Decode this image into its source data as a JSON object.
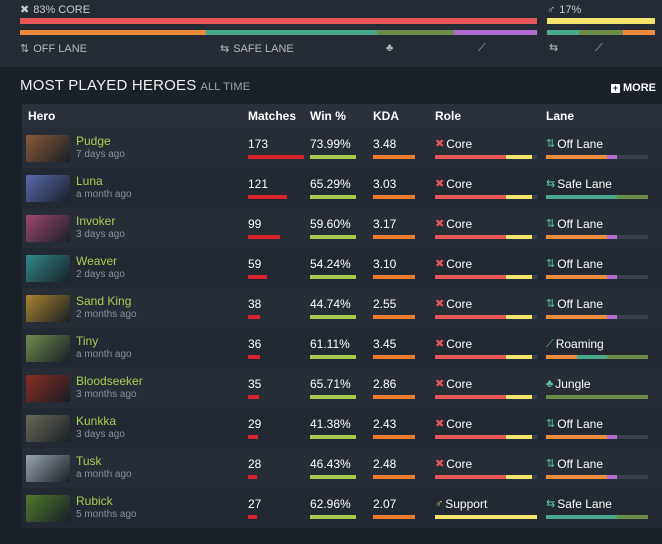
{
  "top_panel": {
    "role_percent_label": "83% CORE",
    "support_percent_label": "17%",
    "lane_labels": [
      "OFF LANE",
      "SAFE LANE"
    ],
    "core_icon": "core-role-icon",
    "support_icon": "support-role-icon",
    "colors": {
      "core": "#e8575a",
      "support": "#f2e46d"
    },
    "lane_distribution": [
      {
        "lane": "off lane",
        "color": "#ee8a3c",
        "fraction": 0.36
      },
      {
        "lane": "safe lane",
        "color": "#4aa98c",
        "fraction": 0.33
      },
      {
        "lane": "jungle",
        "color": "#6d8b4a",
        "fraction": 0.15
      },
      {
        "lane": "roaming",
        "color": "#b06bd0",
        "fraction": 0.16
      }
    ],
    "support_lane_distribution": [
      {
        "lane": "safe lane",
        "color": "#4aa98c",
        "fraction": 0.3
      },
      {
        "lane": "roaming",
        "color": "#6d8b4a",
        "fraction": 0.4
      },
      {
        "lane": "other",
        "color": "#ee8a3c",
        "fraction": 0.3
      }
    ]
  },
  "section": {
    "title": "MOST PLAYED HEROES",
    "subtitle": "ALL TIME",
    "more_label": "MORE"
  },
  "table": {
    "headers": {
      "hero": "Hero",
      "matches": "Matches",
      "win": "Win %",
      "kda": "KDA",
      "role": "Role",
      "lane": "Lane"
    },
    "rows": [
      {
        "hero": "Pudge",
        "ago": "7 days ago",
        "matches": "173",
        "win": "73.99%",
        "kda": "3.48",
        "role": "Core",
        "lane": "Off Lane",
        "portrait": "#8a5a3a",
        "match_frac": 1.0,
        "win_frac": 0.74,
        "role_type": "core",
        "lane_type": "off"
      },
      {
        "hero": "Luna",
        "ago": "a month ago",
        "matches": "121",
        "win": "65.29%",
        "kda": "3.03",
        "role": "Core",
        "lane": "Safe Lane",
        "portrait": "#5a6ab0",
        "match_frac": 0.7,
        "win_frac": 0.65,
        "role_type": "core",
        "lane_type": "safe"
      },
      {
        "hero": "Invoker",
        "ago": "3 days ago",
        "matches": "99",
        "win": "59.60%",
        "kda": "3.17",
        "role": "Core",
        "lane": "Off Lane",
        "portrait": "#a04870",
        "match_frac": 0.57,
        "win_frac": 0.6,
        "role_type": "core",
        "lane_type": "off"
      },
      {
        "hero": "Weaver",
        "ago": "2 days ago",
        "matches": "59",
        "win": "54.24%",
        "kda": "3.10",
        "role": "Core",
        "lane": "Off Lane",
        "portrait": "#2f8a8a",
        "match_frac": 0.34,
        "win_frac": 0.54,
        "role_type": "core",
        "lane_type": "off"
      },
      {
        "hero": "Sand King",
        "ago": "2 months ago",
        "matches": "38",
        "win": "44.74%",
        "kda": "2.55",
        "role": "Core",
        "lane": "Off Lane",
        "portrait": "#a8842e",
        "match_frac": 0.22,
        "win_frac": 0.45,
        "role_type": "core",
        "lane_type": "off"
      },
      {
        "hero": "Tiny",
        "ago": "a month ago",
        "matches": "36",
        "win": "61.11%",
        "kda": "3.45",
        "role": "Core",
        "lane": "Roaming",
        "portrait": "#6f8a4e",
        "match_frac": 0.21,
        "win_frac": 0.61,
        "role_type": "core",
        "lane_type": "roam"
      },
      {
        "hero": "Bloodseeker",
        "ago": "3 months ago",
        "matches": "35",
        "win": "65.71%",
        "kda": "2.86",
        "role": "Core",
        "lane": "Jungle",
        "portrait": "#8a2a22",
        "match_frac": 0.2,
        "win_frac": 0.66,
        "role_type": "core",
        "lane_type": "jungle"
      },
      {
        "hero": "Kunkka",
        "ago": "3 days ago",
        "matches": "29",
        "win": "41.38%",
        "kda": "2.43",
        "role": "Core",
        "lane": "Off Lane",
        "portrait": "#6a6a58",
        "match_frac": 0.17,
        "win_frac": 0.41,
        "role_type": "core",
        "lane_type": "off"
      },
      {
        "hero": "Tusk",
        "ago": "a month ago",
        "matches": "28",
        "win": "46.43%",
        "kda": "2.48",
        "role": "Core",
        "lane": "Off Lane",
        "portrait": "#9aa6b0",
        "match_frac": 0.16,
        "win_frac": 0.46,
        "role_type": "core",
        "lane_type": "off"
      },
      {
        "hero": "Rubick",
        "ago": "5 months ago",
        "matches": "27",
        "win": "62.96%",
        "kda": "2.07",
        "role": "Support",
        "lane": "Safe Lane",
        "portrait": "#4f7a2e",
        "match_frac": 0.16,
        "win_frac": 0.63,
        "role_type": "support",
        "lane_type": "safe"
      }
    ]
  }
}
